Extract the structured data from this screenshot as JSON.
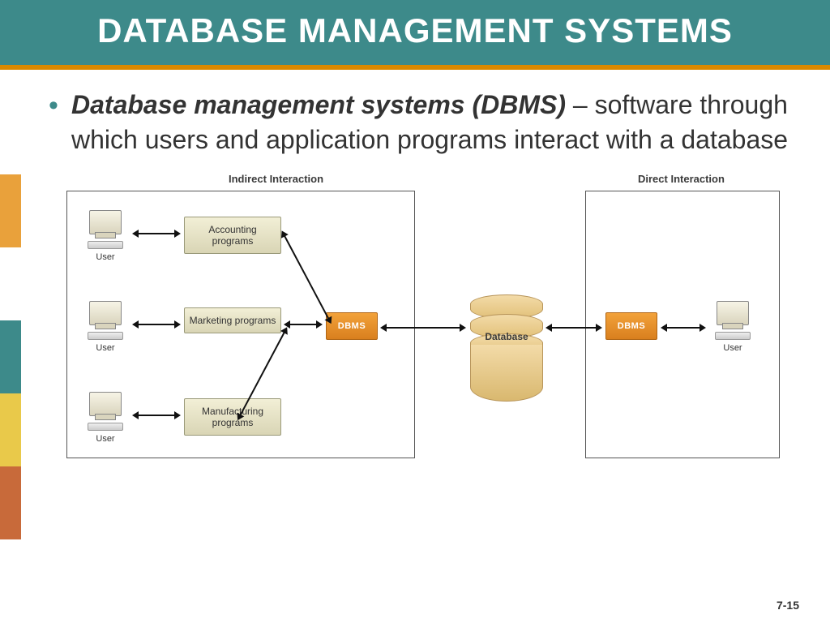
{
  "title": "DATABASE MANAGEMENT SYSTEMS",
  "bullet": {
    "bold": "Database management systems (DBMS)",
    "rest": " – software through which users and application programs interact with a database"
  },
  "diagram": {
    "headers": {
      "left": "Indirect Interaction",
      "right": "Direct Interaction"
    },
    "user_label": "User",
    "programs": [
      "Accounting programs",
      "Marketing programs",
      "Manufacturing programs"
    ],
    "dbms_label": "DBMS",
    "database_label": "Database"
  },
  "page_number": "7-15"
}
